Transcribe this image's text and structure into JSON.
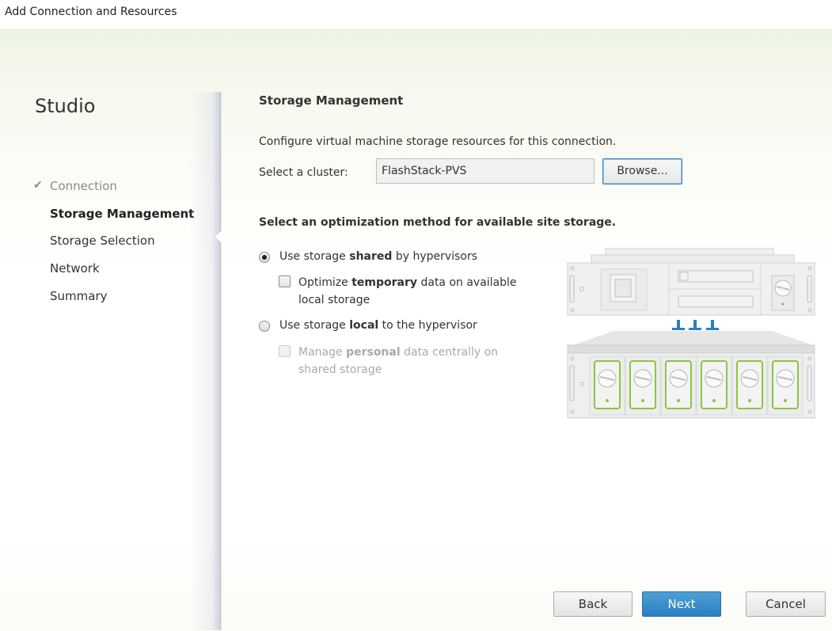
{
  "window": {
    "title": "Add Connection and Resources"
  },
  "sidebar": {
    "brand": "Studio",
    "steps": [
      {
        "label": "Connection",
        "state": "completed",
        "icon": "checkmark-icon"
      },
      {
        "label": "Storage Management",
        "state": "current"
      },
      {
        "label": "Storage Selection",
        "state": "pending"
      },
      {
        "label": "Network",
        "state": "pending"
      },
      {
        "label": "Summary",
        "state": "pending"
      }
    ]
  },
  "main": {
    "heading": "Storage Management",
    "description": "Configure virtual machine storage resources for this connection.",
    "cluster": {
      "label": "Select a cluster:",
      "value": "FlashStack-PVS",
      "browse_label": "Browse..."
    },
    "optimization_heading": "Select an optimization method for available site storage.",
    "options": [
      {
        "type": "radio",
        "checked": true,
        "prefix": "Use storage ",
        "bold": "shared",
        "suffix": " by hypervisors",
        "sub": {
          "type": "checkbox",
          "checked": false,
          "disabled": false,
          "prefix": "Optimize ",
          "bold": "temporary",
          "suffix": " data on available local storage"
        }
      },
      {
        "type": "radio",
        "checked": false,
        "prefix": "Use storage ",
        "bold": "local",
        "suffix": " to the hypervisor",
        "sub": {
          "type": "checkbox",
          "checked": false,
          "disabled": true,
          "prefix": "Manage ",
          "bold": "personal",
          "suffix": " data centrally on shared storage"
        }
      }
    ],
    "illustration": {
      "name": "server-shared-storage-illustration",
      "accent_color": "#8cc63f",
      "link_color": "#2b7fbf"
    }
  },
  "footer": {
    "back_label": "Back",
    "next_label": "Next",
    "cancel_label": "Cancel"
  }
}
